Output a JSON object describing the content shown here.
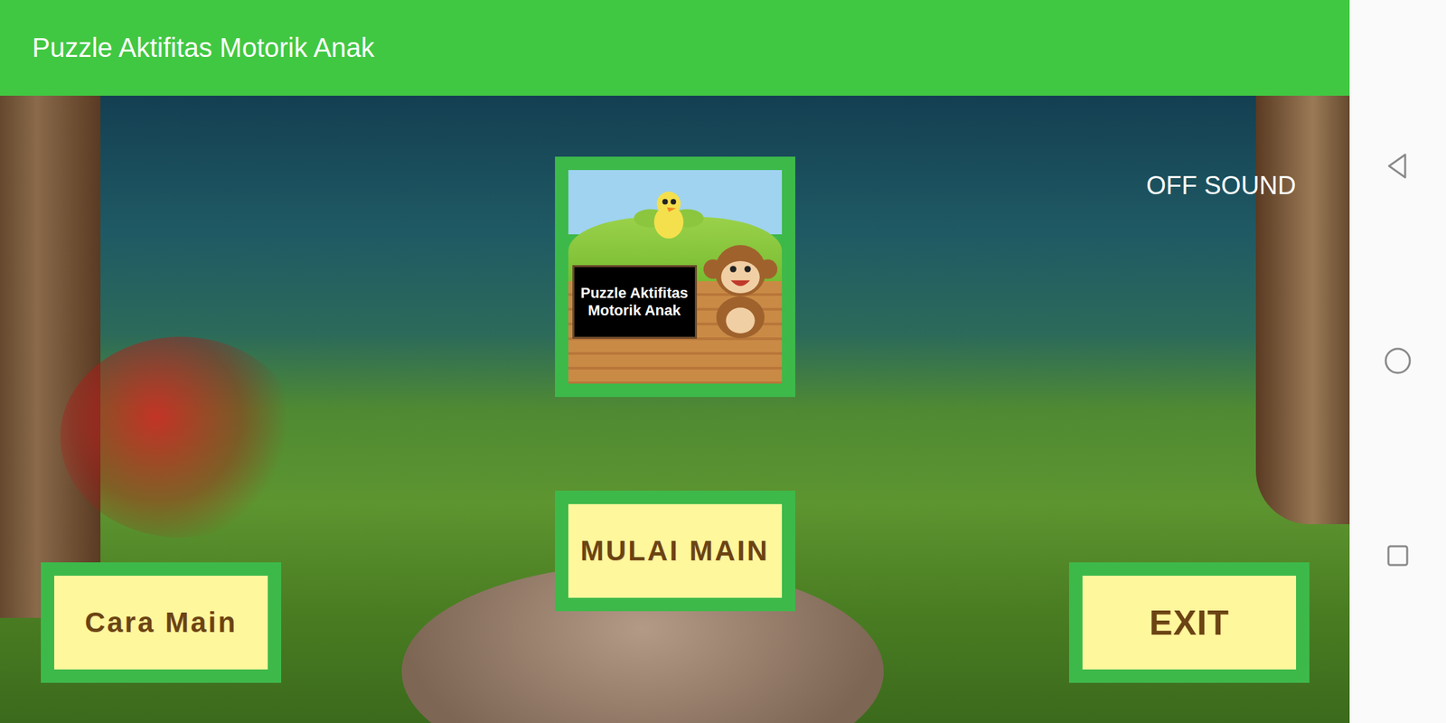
{
  "app_bar": {
    "title": "Puzzle Aktifitas Motorik Anak"
  },
  "logo": {
    "text": "Puzzle Aktifitas Motorik Anak"
  },
  "sound_toggle": {
    "label": "OFF SOUND"
  },
  "menu": {
    "how_to_play": "Cara Main",
    "start": "MULAI MAIN",
    "exit": "EXIT"
  }
}
